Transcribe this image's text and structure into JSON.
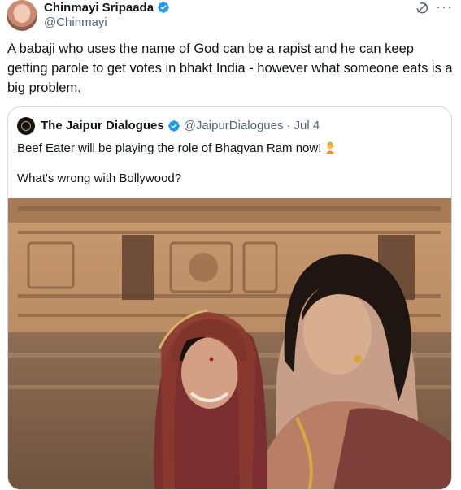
{
  "author": {
    "display_name": "Chinmayi Sripaada",
    "handle": "@Chinmayi",
    "avatar_icon": "profile-avatar",
    "verified": true
  },
  "header_icons": {
    "grok": "grok-icon",
    "more": "more-horizontal-icon"
  },
  "tweet": {
    "text": "A babaji who uses the name of God can be a rapist and he can keep getting parole to get votes in bhakt India - however what someone eats is a big problem."
  },
  "quoted_tweet": {
    "display_name": "The Jaipur Dialogues",
    "handle": "@JaipurDialogues",
    "separator": "·",
    "date": "Jul 4",
    "verified": true,
    "line1": "Beef Eater will be playing the role of Bhagvan Ram now!",
    "line1_emoji": "facepalm-emoji",
    "line2": "What's wrong with Bollywood?"
  },
  "colors": {
    "text": "#0f1419",
    "secondary": "#536471",
    "verified_blue": "#1d9bf0",
    "border": "#cfd9de"
  }
}
